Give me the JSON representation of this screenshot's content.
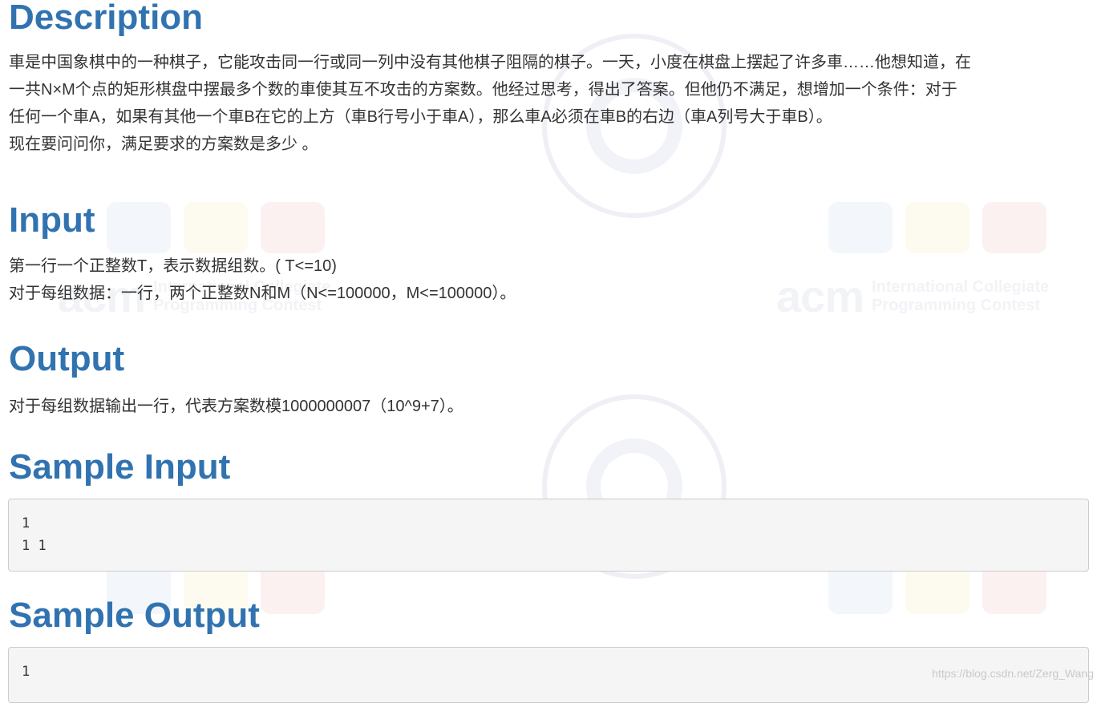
{
  "description": {
    "heading": "Description",
    "lines": [
      "車是中国象棋中的一种棋子，它能攻击同一行或同一列中没有其他棋子阻隔的棋子。一天，小度在棋盘上摆起了许多車……他想知道，在",
      "一共N×M个点的矩形棋盘中摆最多个数的車使其互不攻击的方案数。他经过思考，得出了答案。但他仍不满足，想增加一个条件：对于",
      "任何一个車A，如果有其他一个車B在它的上方（車B行号小于車A），那么車A必须在車B的右边（車A列号大于車B）。",
      "现在要问问你，满足要求的方案数是多少 。"
    ]
  },
  "input": {
    "heading": "Input",
    "lines": [
      "第一行一个正整数T，表示数据组数。( T<=10)",
      "对于每组数据：一行，两个正整数N和M（N<=100000，M<=100000）。"
    ]
  },
  "output": {
    "heading": "Output",
    "lines": [
      "对于每组数据输出一行，代表方案数模1000000007（10^9+7）。"
    ]
  },
  "sample_input": {
    "heading": "Sample Input",
    "lines": [
      "1",
      "1 1"
    ]
  },
  "sample_output": {
    "heading": "Sample Output",
    "lines": [
      "1"
    ]
  },
  "watermark": {
    "acm_big": "acm",
    "acm_line1": "International Collegiate",
    "acm_line2": "Programming Contest",
    "credit": "https://blog.csdn.net/Zerg_Wang"
  },
  "colors": {
    "heading": "#3173b0",
    "text": "#333333",
    "code_bg": "#f5f5f5",
    "code_border": "#cccccc"
  }
}
